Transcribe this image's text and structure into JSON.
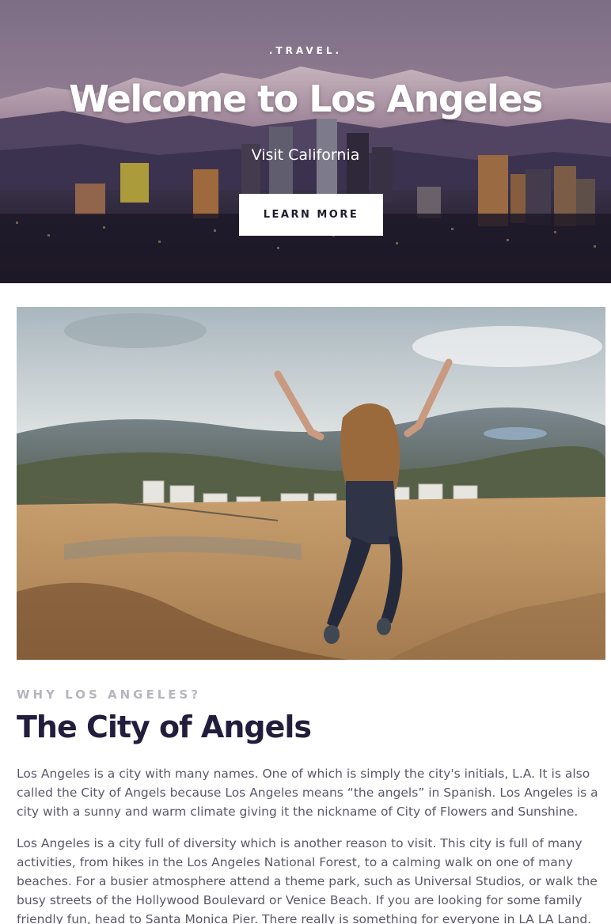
{
  "hero": {
    "tag": ".TRAVEL.",
    "title": "Welcome to Los Angeles",
    "subtitle": "Visit California",
    "button_label": "LEARN MORE"
  },
  "photo": {
    "subject": "hollywood-hike-photo"
  },
  "article": {
    "eyebrow": "WHY LOS ANGELES?",
    "title": "The City of Angels",
    "paragraphs": [
      "Los Angeles is a city with many names. One of which is simply the city's initials, L.A. It is also called the City of Angels because Los Angeles means “the angels” in Spanish. Los Angeles is a city with a sunny and warm climate giving it the nickname of City of Flowers and Sunshine.",
      "Los Angeles is a city full of diversity which is another reason to visit. This city is full of many activities, from hikes in the Los Angeles National Forest, to a calming walk on one of many beaches. For a busier atmosphere attend a theme park, such as Universal Studios, or walk the busy streets of the Hollywood Boulevard or Venice Beach. If you are looking for some family friendly fun, head to Santa Monica Pier. There really is something for everyone in LA LA Land."
    ]
  },
  "colors": {
    "title_dark": "#231d3d",
    "eyebrow_gray": "#b7b4bd",
    "body_text": "#5b5868",
    "button_bg": "#ffffff"
  }
}
